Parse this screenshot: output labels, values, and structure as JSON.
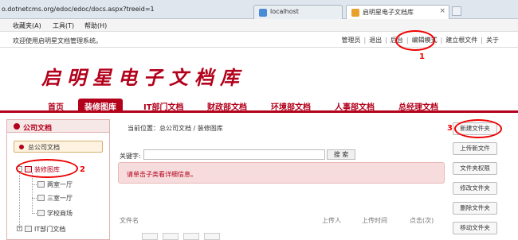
{
  "browser": {
    "url": "o.dotnetcms.org/edoc/edoc/docs.aspx?treeid=1",
    "tabs": [
      {
        "label": "localhost"
      },
      {
        "label": "启明星电子文档库"
      }
    ]
  },
  "menubar": [
    "收藏夹(A)",
    "工具(T)",
    "帮助(H)"
  ],
  "infobar": {
    "welcome": "欢迎使用启明星文档管理系统。",
    "links": [
      "管理员",
      "退出",
      "后台",
      "编辑模式",
      "建立根文件",
      "关于"
    ]
  },
  "header": {
    "site_title": "启明星电子文档库"
  },
  "nav": [
    "首页",
    "装修图库",
    "IT部门文档",
    "财政部文档",
    "环境部文档",
    "人事部文档",
    "总经理文档"
  ],
  "sidebar": {
    "title": "公司文档",
    "company_button": "总公司文档",
    "tree": [
      "装修图库",
      "两室一厅",
      "三室一厅",
      "学校商场",
      "IT部门文档"
    ]
  },
  "main": {
    "breadcrumb": "当前位置：总公司文档 / 装修图库",
    "search_label": "关键字:",
    "search_button": "搜 索",
    "notice": "请单击子类看详细信息。",
    "columns": [
      "文件名",
      "上传人",
      "上传时间",
      "点击(次)"
    ]
  },
  "actions": [
    "新建文件夹",
    "上传新文件",
    "文件夹权限",
    "修改文件夹",
    "删除文件夹",
    "移动文件夹"
  ],
  "annotations": [
    "1",
    "2",
    "3"
  ],
  "colors": {
    "brand": "#b3001b",
    "annotation": "#e00000"
  }
}
